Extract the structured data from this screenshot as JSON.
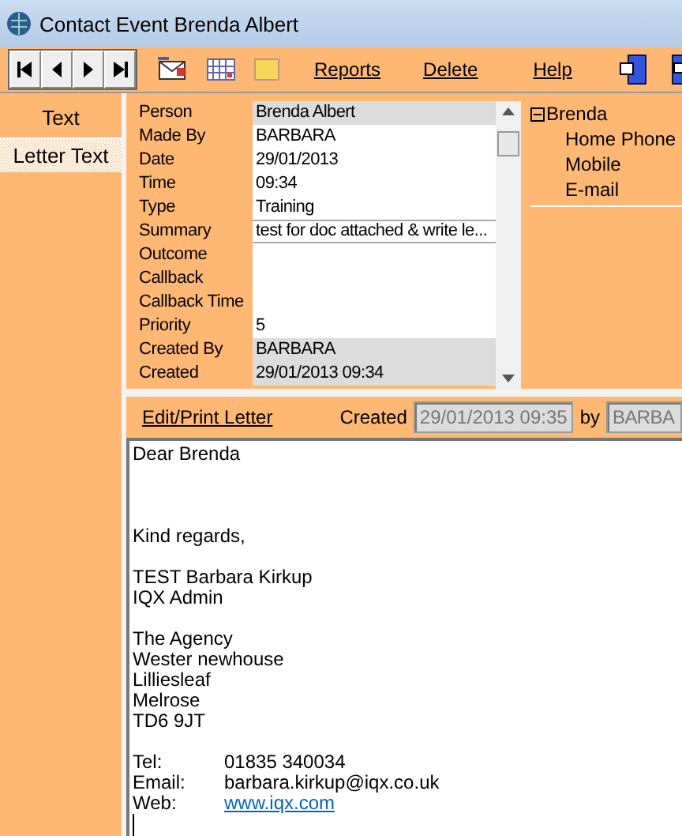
{
  "window": {
    "title": "Contact Event Brenda Albert"
  },
  "toolbar": {
    "links": [
      "Reports",
      "Delete",
      "Help"
    ]
  },
  "tabs": [
    {
      "label": "Text",
      "selected": false
    },
    {
      "label": "Letter Text",
      "selected": true
    }
  ],
  "fields": [
    {
      "label": "Person",
      "value": "Brenda Albert",
      "readonly": true
    },
    {
      "label": "Made By",
      "value": "BARBARA",
      "readonly": false
    },
    {
      "label": "Date",
      "value": "29/01/2013",
      "readonly": false
    },
    {
      "label": "Time",
      "value": "09:34",
      "readonly": false
    },
    {
      "label": "Type",
      "value": "Training",
      "readonly": false
    },
    {
      "label": "Summary",
      "value": "test for doc attached & write le...",
      "readonly": false
    },
    {
      "label": "Outcome",
      "readonly": false
    },
    {
      "label": "Callback",
      "readonly": false
    },
    {
      "label": "Callback Time",
      "readonly": false
    },
    {
      "label": "Priority",
      "value": "5",
      "readonly": false
    },
    {
      "label": "Created By",
      "value": "BARBARA",
      "readonly": true
    },
    {
      "label": "Created",
      "value": "29/01/2013 09:34",
      "readonly": true
    }
  ],
  "tree": {
    "label": "Brenda",
    "expanded": true,
    "children": [
      {
        "label": "Home Phone"
      },
      {
        "label": "Mobile"
      },
      {
        "label": "E-mail"
      }
    ]
  },
  "letter_bar": {
    "link": "Edit/Print Letter",
    "created_label": "Created",
    "created_value": "29/01/2013 09:35",
    "by_label": "by",
    "by_value": "BARBA"
  },
  "letter": [
    {
      "kind": "text",
      "text": "Dear Brenda"
    },
    {
      "kind": "gap"
    },
    {
      "kind": "gap"
    },
    {
      "kind": "gap"
    },
    {
      "kind": "text",
      "text": "Kind regards,"
    },
    {
      "kind": "gap"
    },
    {
      "kind": "text",
      "text": "TEST Barbara Kirkup"
    },
    {
      "kind": "text",
      "text": "IQX Admin"
    },
    {
      "kind": "gap"
    },
    {
      "kind": "text",
      "text": "The Agency"
    },
    {
      "kind": "text",
      "text": "Wester newhouse"
    },
    {
      "kind": "text",
      "text": "Lilliesleaf"
    },
    {
      "kind": "text",
      "text": "Melrose"
    },
    {
      "kind": "text",
      "text": "TD6 9JT"
    },
    {
      "kind": "gap"
    },
    {
      "kind": "contact",
      "label": "Tel:",
      "value": "01835 340034"
    },
    {
      "kind": "contact",
      "label": "Email:",
      "value": "barbara.kirkup@iqx.co.uk"
    },
    {
      "kind": "link",
      "label": "Web:",
      "value": "www.iqx.com"
    }
  ]
}
